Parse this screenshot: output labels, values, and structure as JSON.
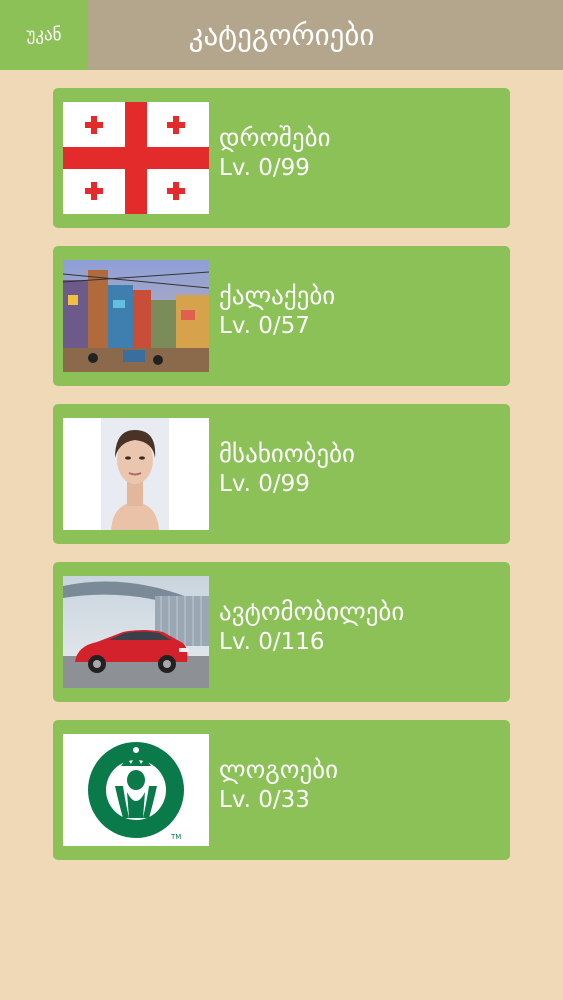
{
  "header": {
    "back_label": "უკან",
    "title": "კატეგორიები"
  },
  "categories": [
    {
      "name": "დროშები",
      "level": "Lv. 0/99",
      "thumbnail": "georgia-flag"
    },
    {
      "name": "ქალაქები",
      "level": "Lv. 0/57",
      "thumbnail": "city-street-photo"
    },
    {
      "name": "მსახიობები",
      "level": "Lv. 0/99",
      "thumbnail": "actress-portrait-photo"
    },
    {
      "name": "ავტომობილები",
      "level": "Lv. 0/116",
      "thumbnail": "red-car-photo"
    },
    {
      "name": "ლოგოები",
      "level": "Lv. 0/33",
      "thumbnail": "starbucks-logo"
    }
  ],
  "colors": {
    "background": "#efd9b6",
    "header": "#b4a68c",
    "accent_green": "#8bc157"
  }
}
